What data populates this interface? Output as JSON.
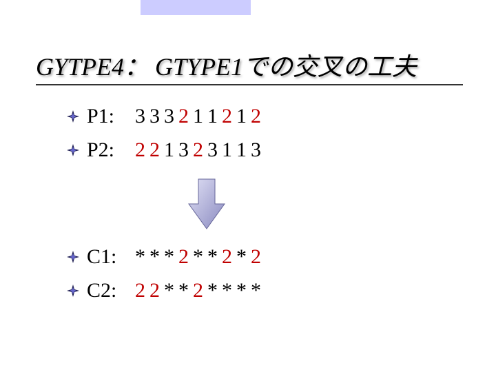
{
  "title": "GYTPE4： GTYPE1での交叉の工夫",
  "bullet_glyph": "diamond-star",
  "rows_top": [
    {
      "label": "P1:",
      "seq": [
        "3",
        "3",
        "3",
        "2",
        "1",
        "1",
        "2",
        "1",
        "2"
      ],
      "red_idx": [
        3,
        6,
        8
      ]
    },
    {
      "label": "P2:",
      "seq": [
        "2",
        "2",
        "1",
        "3",
        "2",
        "3",
        "1",
        "1",
        "3"
      ],
      "red_idx": [
        0,
        1,
        4
      ]
    }
  ],
  "rows_bottom": [
    {
      "label": "C1:",
      "seq": [
        "*",
        "*",
        "*",
        "2",
        "*",
        "*",
        "2",
        "*",
        "2"
      ],
      "red_idx": [
        3,
        6,
        8
      ]
    },
    {
      "label": "C2:",
      "seq": [
        "2",
        "2",
        "*",
        "*",
        "2",
        "*",
        "*",
        "*",
        "*"
      ],
      "red_idx": [
        0,
        1,
        4
      ]
    }
  ],
  "arrow_color": "#9c9cce"
}
